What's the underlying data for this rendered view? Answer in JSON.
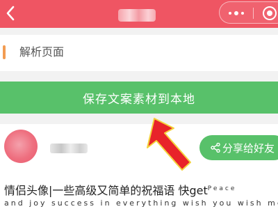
{
  "navbar": {
    "background": "#ef5563",
    "title_obscured": true,
    "icons": {
      "back": "chevron-left-icon",
      "more": "more-dots-icon",
      "close": "target-circle-icon"
    }
  },
  "parse_section": {
    "label": "解析页面",
    "accent_color": "#f29c52"
  },
  "save_button": {
    "label": "保存文案素材到本地",
    "color": "#58c16a"
  },
  "post": {
    "author_name_obscured": true,
    "share_button": {
      "label": "分享给好友",
      "icon": "share-icon"
    },
    "title_main": "情侣头像|一些高级又简单的祝福语 快get",
    "title_super": "Peace",
    "body_line": "and joy success in everything wish you wish me"
  },
  "annotation": {
    "type": "red-arrow",
    "color": "#e8232a",
    "points_to": "save_button"
  }
}
